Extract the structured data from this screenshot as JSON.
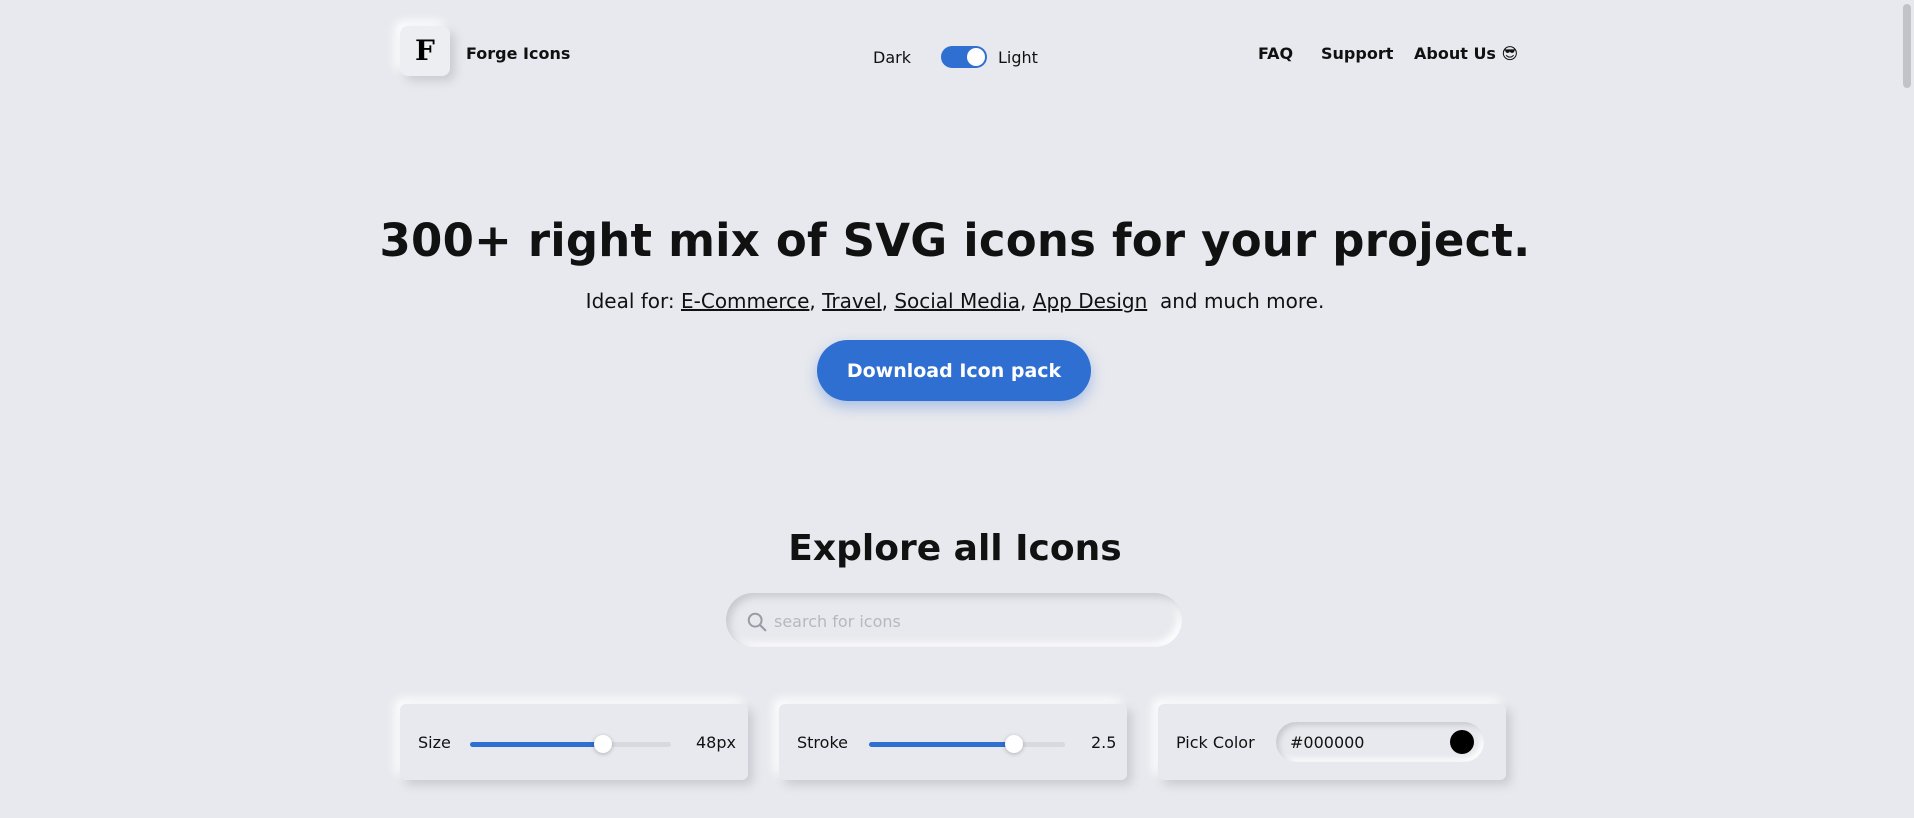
{
  "header": {
    "logo_letter": "F",
    "brand": "Forge Icons",
    "theme": {
      "dark_label": "Dark",
      "light_label": "Light",
      "is_light": true
    },
    "nav": [
      {
        "label": "FAQ"
      },
      {
        "label": "Support"
      },
      {
        "label": "About Us 😎"
      }
    ]
  },
  "hero": {
    "title": "300+ right mix of SVG icons for your project.",
    "ideal_prefix": "Ideal for:",
    "ideal_links": [
      "E-Commerce",
      "Travel",
      "Social Media",
      "App Design"
    ],
    "ideal_suffix": "and much more.",
    "download_label": "Download Icon pack"
  },
  "explore": {
    "title": "Explore all Icons",
    "search_placeholder": "search for icons",
    "search_icon": "search-icon"
  },
  "controls": {
    "size": {
      "label": "Size",
      "value": "48px",
      "fill_fraction": 0.66
    },
    "stroke": {
      "label": "Stroke",
      "value": "2.5",
      "fill_fraction": 0.74
    },
    "color": {
      "label": "Pick Color",
      "value": "#000000",
      "swatch": "#000000"
    }
  },
  "colors": {
    "accent": "#2f6fd2",
    "background": "#e8e9ee"
  }
}
